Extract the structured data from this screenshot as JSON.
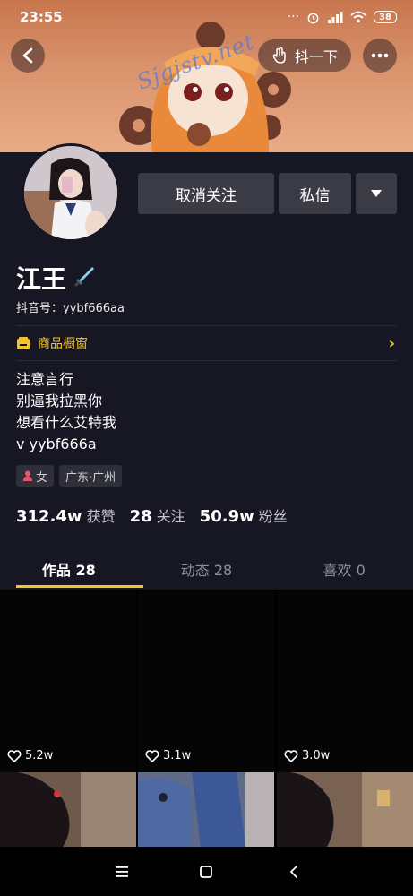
{
  "status_bar": {
    "time": "23:55",
    "battery": "38"
  },
  "header": {
    "shake_label": "抖一下",
    "watermark": "Sjgjstv.net"
  },
  "profile": {
    "name": "江王",
    "douyin_id": "抖音号：yybf666aa",
    "shop_label": "商品橱窗",
    "bio": [
      "注意言行",
      "别逼我拉黑你",
      "想看什么艾特我",
      "v yybf666a"
    ],
    "tags": {
      "gender": "女",
      "location": "广东·广州"
    }
  },
  "actions": {
    "unfollow": "取消关注",
    "message": "私信"
  },
  "stats": [
    {
      "num": "312.4w",
      "label": "获赞"
    },
    {
      "num": "28",
      "label": "关注"
    },
    {
      "num": "50.9w",
      "label": "粉丝"
    }
  ],
  "tabs": [
    {
      "label": "作品 28",
      "active": true
    },
    {
      "label": "动态 28",
      "active": false
    },
    {
      "label": "喜欢 0",
      "active": false
    }
  ],
  "videos": [
    {
      "likes": "5.2w"
    },
    {
      "likes": "3.1w"
    },
    {
      "likes": "3.0w"
    }
  ],
  "colors": {
    "accent": "#f3c42e",
    "background": "#161722",
    "button": "#3a3b44"
  },
  "icons": [
    "back-icon",
    "shake-hand-icon",
    "more-icon",
    "dropdown-icon",
    "shop-icon",
    "female-icon",
    "heart-icon",
    "menu-icon",
    "home-icon",
    "back-nav-icon"
  ]
}
